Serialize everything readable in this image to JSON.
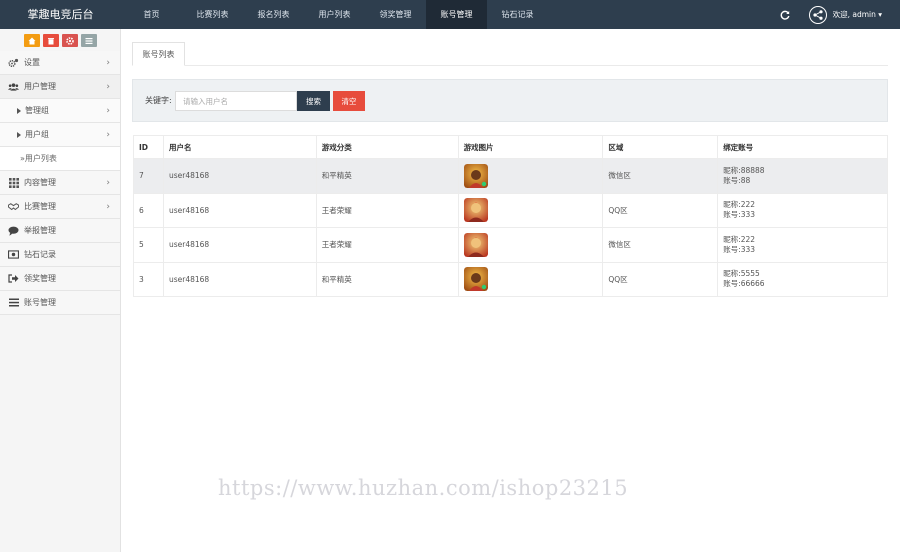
{
  "app": {
    "title": "掌趣电竞后台"
  },
  "topnav": [
    {
      "label": "首页",
      "active": false
    },
    {
      "label": "比赛列表",
      "active": false
    },
    {
      "label": "报名列表",
      "active": false
    },
    {
      "label": "用户列表",
      "active": false
    },
    {
      "label": "领奖管理",
      "active": false
    },
    {
      "label": "账号管理",
      "active": true
    },
    {
      "label": "钻石记录",
      "active": false
    }
  ],
  "user": {
    "welcome": "欢迎, admin ▾"
  },
  "sidebar": {
    "items": [
      {
        "label": "设置",
        "icon": "gears-icon",
        "arrow": true
      },
      {
        "label": "用户管理",
        "icon": "users-icon",
        "arrow": true
      },
      {
        "label": "管理组",
        "icon": "caret-right-icon",
        "arrow": true,
        "level": 2
      },
      {
        "label": "用户组",
        "icon": "caret-right-icon",
        "arrow": true,
        "level": 2
      },
      {
        "label": "»用户列表",
        "level": 3
      },
      {
        "label": "内容管理",
        "icon": "grid-icon",
        "arrow": true
      },
      {
        "label": "比赛管理",
        "icon": "handshake-icon",
        "arrow": true
      },
      {
        "label": "举报管理",
        "icon": "comment-icon",
        "arrow": false
      },
      {
        "label": "钻石记录",
        "icon": "money-icon",
        "arrow": false
      },
      {
        "label": "领奖管理",
        "icon": "signout-icon",
        "arrow": false
      },
      {
        "label": "账号管理",
        "icon": "bars-icon",
        "arrow": false
      }
    ]
  },
  "tabs": {
    "active": "账号列表"
  },
  "search": {
    "label": "关键字:",
    "placeholder": "请输入用户名",
    "search_button": "搜索",
    "clear_button": "清空"
  },
  "table": {
    "headers": [
      "ID",
      "用户名",
      "游戏分类",
      "游戏图片",
      "区域",
      "绑定账号"
    ],
    "rows": [
      {
        "id": "7",
        "username": "user48168",
        "category": "和平精英",
        "region": "微信区",
        "nickname": "昵称:88888",
        "account": "账号:88",
        "highlighted": true
      },
      {
        "id": "6",
        "username": "user48168",
        "category": "王者荣耀",
        "region": "QQ区",
        "nickname": "昵称:222",
        "account": "账号:333",
        "highlighted": false
      },
      {
        "id": "5",
        "username": "user48168",
        "category": "王者荣耀",
        "region": "微信区",
        "nickname": "昵称:222",
        "account": "账号:333",
        "highlighted": false
      },
      {
        "id": "3",
        "username": "user48168",
        "category": "和平精英",
        "region": "QQ区",
        "nickname": "昵称:5555",
        "account": "账号:66666",
        "highlighted": false
      }
    ]
  },
  "watermark": "https://www.huzhan.com/ishop23215",
  "colors": {
    "topbar": "#2e3e4e",
    "active_nav": "#1f2a36",
    "search_btn": "#2e3e4e",
    "clear_btn": "#e74c3c"
  }
}
